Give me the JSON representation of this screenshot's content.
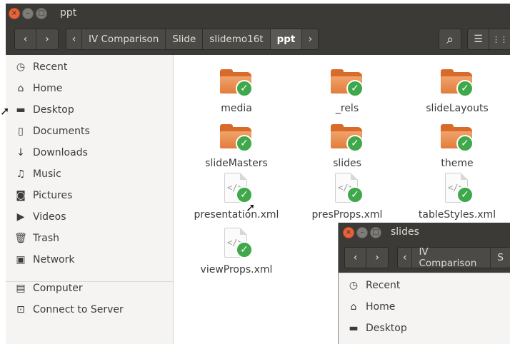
{
  "window": {
    "title": "ppt",
    "buttons": {
      "close": "×",
      "minimize": "–",
      "maximize": "□"
    }
  },
  "toolbar": {
    "back": "‹",
    "forward": "›",
    "crumb_scroll_left": "‹",
    "crumb_scroll_right": "›",
    "breadcrumbs": [
      "IV Comparison",
      "Slide",
      "slidemo16t",
      "ppt"
    ],
    "search_icon": "⌕",
    "list_view_icon": "☰",
    "grid_view_icon": "⋮⋮"
  },
  "sidebar": {
    "items": [
      {
        "label": "Recent",
        "icon": "clock-icon",
        "glyph": "◷"
      },
      {
        "label": "Home",
        "icon": "home-icon",
        "glyph": "⌂"
      },
      {
        "label": "Desktop",
        "icon": "folder-icon",
        "glyph": "▬"
      },
      {
        "label": "Documents",
        "icon": "document-icon",
        "glyph": "▯"
      },
      {
        "label": "Downloads",
        "icon": "download-icon",
        "glyph": "↓"
      },
      {
        "label": "Music",
        "icon": "music-icon",
        "glyph": "♫"
      },
      {
        "label": "Pictures",
        "icon": "camera-icon",
        "glyph": "◙"
      },
      {
        "label": "Videos",
        "icon": "video-icon",
        "glyph": "▶"
      },
      {
        "label": "Trash",
        "icon": "trash-icon",
        "glyph": "🗑"
      },
      {
        "label": "Network",
        "icon": "network-icon",
        "glyph": "▣"
      },
      {
        "label": "Computer",
        "icon": "computer-icon",
        "glyph": "▤"
      },
      {
        "label": "Connect to Server",
        "icon": "server-icon",
        "glyph": "⊡"
      }
    ]
  },
  "files": [
    {
      "name": "media",
      "type": "folder"
    },
    {
      "name": "_rels",
      "type": "folder"
    },
    {
      "name": "slideLayouts",
      "type": "folder"
    },
    {
      "name": "slideMasters",
      "type": "folder"
    },
    {
      "name": "slides",
      "type": "folder"
    },
    {
      "name": "theme",
      "type": "folder"
    },
    {
      "name": "presentation.xml",
      "type": "xml"
    },
    {
      "name": "presProps.xml",
      "type": "xml"
    },
    {
      "name": "tableStyles.xml",
      "type": "xml"
    },
    {
      "name": "viewProps.xml",
      "type": "xml"
    }
  ],
  "file_badge": "✓",
  "xml_glyph": "</>",
  "second_window": {
    "title": "slides",
    "breadcrumbs": [
      "IV Comparison",
      "S"
    ],
    "sidebar_items": [
      {
        "label": "Recent",
        "glyph": "◷"
      },
      {
        "label": "Home",
        "glyph": "⌂"
      },
      {
        "label": "Desktop",
        "glyph": "▬"
      }
    ]
  },
  "colors": {
    "titlebar": "#3b3a36",
    "close_button": "#e9623a",
    "folder_orange": "#e27c3c",
    "check_green": "#3fa84a"
  }
}
